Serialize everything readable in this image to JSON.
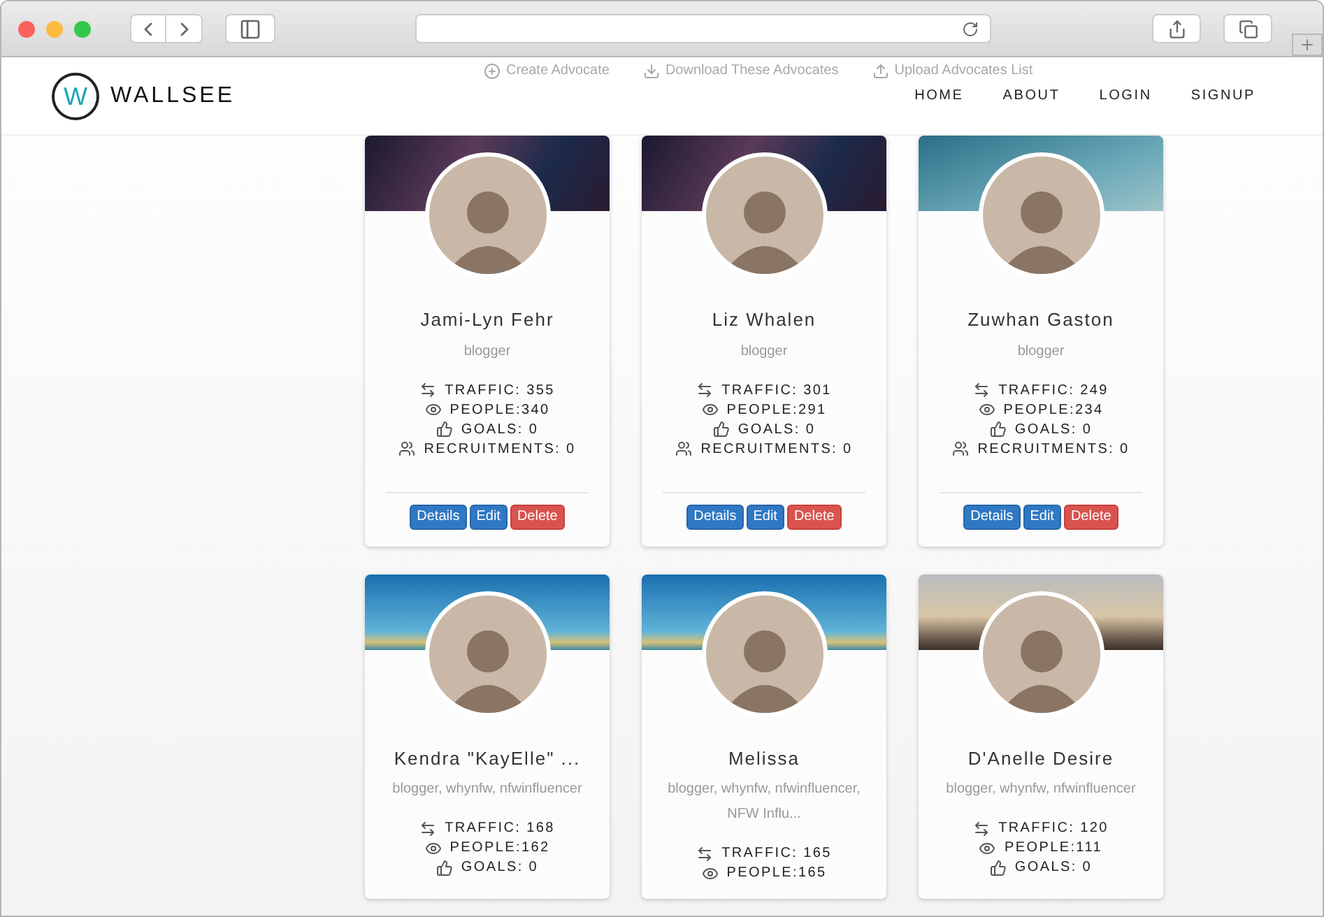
{
  "header": {
    "logo_mark": "W",
    "brand": "WALLSEE",
    "actions": [
      {
        "kind": "create",
        "label": "Create Advocate"
      },
      {
        "kind": "download",
        "label": "Download These Advocates"
      },
      {
        "kind": "upload",
        "label": "Upload Advocates List"
      }
    ],
    "nav": [
      "HOME",
      "ABOUT",
      "LOGIN",
      "SIGNUP"
    ]
  },
  "cards": [
    {
      "name": "Jami-Lyn Fehr",
      "tags": "blogger",
      "stats": [
        {
          "kind": "traffic",
          "text": "TRAFFIC: 355"
        },
        {
          "kind": "people",
          "text": "PEOPLE:340"
        },
        {
          "kind": "goals",
          "text": "GOALS: 0"
        },
        {
          "kind": "recruitments",
          "text": "RECRUITMENTS: 0"
        }
      ],
      "buttons": [
        {
          "kind": "details",
          "label": "Details"
        },
        {
          "kind": "edit",
          "label": "Edit"
        },
        {
          "kind": "delete",
          "label": "Delete"
        }
      ]
    },
    {
      "name": "Liz Whalen",
      "tags": "blogger",
      "stats": [
        {
          "kind": "traffic",
          "text": "TRAFFIC: 301"
        },
        {
          "kind": "people",
          "text": "PEOPLE:291"
        },
        {
          "kind": "goals",
          "text": "GOALS: 0"
        },
        {
          "kind": "recruitments",
          "text": "RECRUITMENTS: 0"
        }
      ],
      "buttons": [
        {
          "kind": "details",
          "label": "Details"
        },
        {
          "kind": "edit",
          "label": "Edit"
        },
        {
          "kind": "delete",
          "label": "Delete"
        }
      ]
    },
    {
      "name": "Zuwhan Gaston",
      "tags": "blogger",
      "stats": [
        {
          "kind": "traffic",
          "text": "TRAFFIC: 249"
        },
        {
          "kind": "people",
          "text": "PEOPLE:234"
        },
        {
          "kind": "goals",
          "text": "GOALS: 0"
        },
        {
          "kind": "recruitments",
          "text": "RECRUITMENTS: 0"
        }
      ],
      "buttons": [
        {
          "kind": "details",
          "label": "Details"
        },
        {
          "kind": "edit",
          "label": "Edit"
        },
        {
          "kind": "delete",
          "label": "Delete"
        }
      ]
    },
    {
      "name": "Kendra \"KayElle\" ...",
      "tags": "blogger, whynfw, nfwinfluencer",
      "stats": [
        {
          "kind": "traffic",
          "text": "TRAFFIC: 168"
        },
        {
          "kind": "people",
          "text": "PEOPLE:162"
        },
        {
          "kind": "goals",
          "text": "GOALS: 0"
        }
      ]
    },
    {
      "name": "Melissa",
      "tags": "blogger, whynfw, nfwinfluencer, NFW Influ...",
      "stats": [
        {
          "kind": "traffic",
          "text": "TRAFFIC: 165"
        },
        {
          "kind": "people",
          "text": "PEOPLE:165"
        }
      ]
    },
    {
      "name": "D'Anelle Desire",
      "tags": "blogger, whynfw, nfwinfluencer",
      "stats": [
        {
          "kind": "traffic",
          "text": "TRAFFIC: 120"
        },
        {
          "kind": "people",
          "text": "PEOPLE:111"
        },
        {
          "kind": "goals",
          "text": "GOALS: 0"
        }
      ]
    }
  ]
}
